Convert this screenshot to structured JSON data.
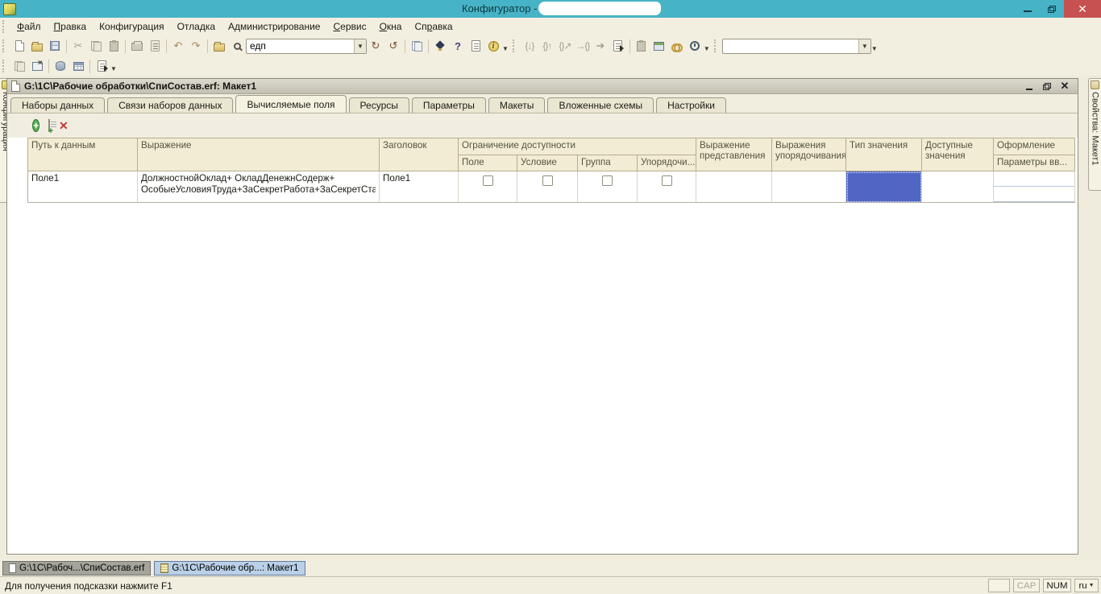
{
  "window": {
    "title": "Конфигуратор - ",
    "controls": [
      "minimize",
      "restore",
      "close"
    ]
  },
  "menu": {
    "items": [
      {
        "pre": "",
        "hot": "Ф",
        "post": "айл"
      },
      {
        "pre": "",
        "hot": "П",
        "post": "равка"
      },
      {
        "pre": "Конфигурация",
        "hot": "",
        "post": ""
      },
      {
        "pre": "Отладка",
        "hot": "",
        "post": ""
      },
      {
        "pre": "Администрирование",
        "hot": "",
        "post": ""
      },
      {
        "pre": "",
        "hot": "С",
        "post": "ервис"
      },
      {
        "pre": "",
        "hot": "О",
        "post": "кна"
      },
      {
        "pre": "Сп",
        "hot": "р",
        "post": "авка"
      }
    ]
  },
  "toolbar_main": {
    "search_value": "едп",
    "window_combo_value": "",
    "icons": [
      "new-document",
      "open",
      "save",
      "cut",
      "copy",
      "paste",
      "print",
      "print-preview",
      "undo",
      "redo",
      "find-in-files",
      "search",
      "find-next",
      "find-previous",
      "show-occurrences",
      "syntax-check",
      "syntax-help-search",
      "code-templates",
      "info",
      "goto-prev-procedure",
      "goto-next-procedure",
      "goto-procedure-start",
      "add-procedure",
      "goto-usage",
      "open-module",
      "clipboard",
      "goto-window",
      "find-references",
      "performance-timer",
      "toolbar-overflow"
    ]
  },
  "toolbar_secondary": {
    "icons": [
      "form-editor",
      "close-all-windows",
      "database-configuration",
      "table-settings",
      "module-document",
      "toolbar-options"
    ]
  },
  "side_tabs": {
    "left": "Конфигурация",
    "right": "Свойства: Макет1"
  },
  "document_window": {
    "title": "G:\\1C\\Рабочие обработки\\СпиСостав.erf: Макет1",
    "tabs": [
      {
        "label": "Наборы данных",
        "active": false
      },
      {
        "label": "Связи наборов данных",
        "active": false
      },
      {
        "label": "Вычисляемые поля",
        "active": true
      },
      {
        "label": "Ресурсы",
        "active": false
      },
      {
        "label": "Параметры",
        "active": false
      },
      {
        "label": "Макеты",
        "active": false
      },
      {
        "label": "Вложенные схемы",
        "active": false
      },
      {
        "label": "Настройки",
        "active": false
      }
    ],
    "fields_toolbar_icons": [
      "add-field",
      "copy-field",
      "delete-field"
    ],
    "table": {
      "col_path": "Путь к данным",
      "col_expr": "Выражение",
      "col_title": "Заголовок",
      "group_access": "Ограничение доступности",
      "access_subs": [
        "Поле",
        "Условие",
        "Группа",
        "Упорядочи..."
      ],
      "col_repr": "Выражение представления",
      "col_order": "Выражения упорядочивания",
      "col_type": "Тип значения",
      "col_avail": "Доступные значения",
      "col_decor": "Оформление",
      "col_decor_sub": "Параметры вв...",
      "row": {
        "path": "Поле1",
        "expr_line1": "ДолжностнойОклад+ ОкладДенежнСодерж+",
        "expr_line2": "ОсобыеУсловияТруда+ЗаСекретРабота+ЗаСекретСта...",
        "title": "Поле1",
        "checkboxes": [
          false,
          false,
          false,
          false
        ]
      },
      "selection": {
        "row": 0,
        "column": "Тип значения"
      }
    }
  },
  "window_bar": {
    "tabs": [
      {
        "label": "G:\\1C\\Рабоч...\\СпиСостав.erf",
        "active": false
      },
      {
        "label": "G:\\1C\\Рабочие обр...: Макет1",
        "active": true
      }
    ]
  },
  "status_bar": {
    "hint": "Для получения подсказки нажмите F1",
    "cap": "CAP",
    "num": "NUM",
    "lang": "ru"
  }
}
